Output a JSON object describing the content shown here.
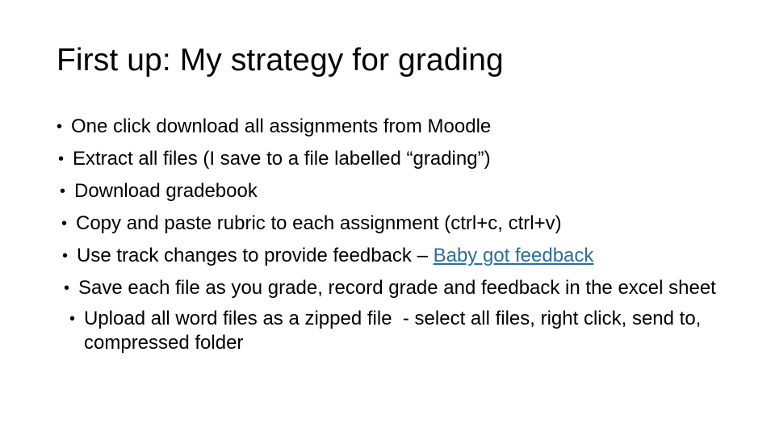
{
  "slide": {
    "title": "First up: My strategy for grading",
    "background_color": "#FFFFFF",
    "text_color": "#000000",
    "link_color": "#2B6E9B",
    "bullet_glyph": "•",
    "bullets": [
      {
        "text": "One click download all assignments from Moodle"
      },
      {
        "text": "Extract all files (I save to a file labelled “grading”)"
      },
      {
        "text": "Download gradebook"
      },
      {
        "text": "Copy and paste rubric to each assignment (ctrl+c, ctrl+v)"
      },
      {
        "text_before_link": "Use track changes to provide feedback – ",
        "link_text": "Baby got feedback"
      },
      {
        "text": "Save each file as you grade, record grade and feedback in the excel sheet"
      },
      {
        "text": "Upload all word files as a zipped file  - select all files, right click, send to, compressed folder"
      }
    ]
  }
}
